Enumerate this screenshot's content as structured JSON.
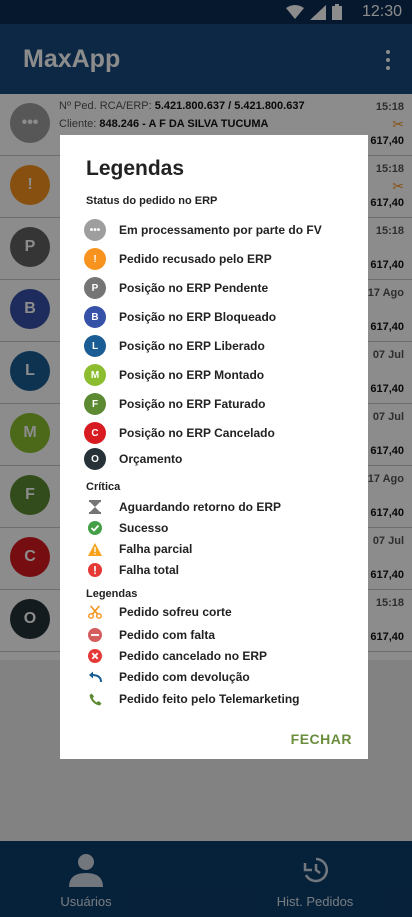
{
  "statusbar": {
    "time": "12:30"
  },
  "app": {
    "title": "MaxApp"
  },
  "orders": [
    {
      "letter": "•••",
      "color": "#9e9e9e",
      "l1_label": "Nº Ped. RCA/ERP: ",
      "l1_value": "5.421.800.637 / 5.421.800.637",
      "l2_label": "Cliente: ",
      "l2_value": "848.246 - A F DA SILVA TUCUMA",
      "time": "15:18",
      "total": "617,40",
      "cut": true
    },
    {
      "letter": "!",
      "color": "#f7931e",
      "l1_label": "",
      "l1_value": "",
      "l2_label": "",
      "l2_value": "",
      "time": "15:18",
      "total": "617,40",
      "cut": true
    },
    {
      "letter": "P",
      "color": "#616161",
      "l1_label": "",
      "l1_value": "",
      "l2_label": "",
      "l2_value": "",
      "time": "15:18",
      "total": "617,40",
      "cut": false
    },
    {
      "letter": "B",
      "color": "#3651a8",
      "l1_label": "",
      "l1_value": "",
      "l2_label": "",
      "l2_value": "",
      "time": "17 Ago",
      "total": "617,40",
      "cut": false
    },
    {
      "letter": "L",
      "color": "#1a5d94",
      "l1_label": "",
      "l1_value": "",
      "l2_label": "",
      "l2_value": "",
      "time": "07 Jul",
      "total": "617,40",
      "cut": false
    },
    {
      "letter": "M",
      "color": "#8bbd2f",
      "l1_label": "",
      "l1_value": "",
      "l2_label": "",
      "l2_value": "",
      "time": "07 Jul",
      "total": "617,40",
      "cut": false
    },
    {
      "letter": "F",
      "color": "#5c8a33",
      "l1_label": "",
      "l1_value": "",
      "l2_label": "",
      "l2_value": "",
      "time": "17 Ago",
      "total": "617,40",
      "cut": false
    },
    {
      "letter": "C",
      "color": "#d81b20",
      "l1_label": "",
      "l1_value": "",
      "l2_label": "",
      "l2_value": "",
      "time": "07 Jul",
      "total": "617,40",
      "cut": false
    },
    {
      "letter": "O",
      "color": "#263238",
      "l1_label": "",
      "l1_value": "",
      "l2_label": "",
      "l2_value": "",
      "time": "15:18",
      "total": "617,40",
      "cut": false
    }
  ],
  "bottomnav": {
    "users": "Usuários",
    "history": "Hist. Pedidos"
  },
  "dialog": {
    "title": "Legendas",
    "status_section": "Status do pedido no ERP",
    "status_items": [
      {
        "letter": "•••",
        "color": "#9e9e9e",
        "label": "Em processamento por parte do FV"
      },
      {
        "letter": "!",
        "color": "#f7931e",
        "label": "Pedido recusado pelo ERP"
      },
      {
        "letter": "P",
        "color": "#757575",
        "label": "Posição no ERP Pendente"
      },
      {
        "letter": "B",
        "color": "#3651a8",
        "label": "Posição no ERP Bloqueado"
      },
      {
        "letter": "L",
        "color": "#1a5d94",
        "label": "Posição no ERP Liberado"
      },
      {
        "letter": "M",
        "color": "#8bbd2f",
        "label": "Posição no ERP Montado"
      },
      {
        "letter": "F",
        "color": "#5c8a33",
        "label": "Posição no ERP Faturado"
      },
      {
        "letter": "C",
        "color": "#d81b20",
        "label": "Posição no ERP Cancelado"
      },
      {
        "letter": "O",
        "color": "#263238",
        "label": "Orçamento"
      }
    ],
    "critica_section": "Crítica",
    "critica_items": [
      {
        "icon": "hourglass-icon",
        "label": "Aguardando retorno do ERP"
      },
      {
        "icon": "success-check-icon",
        "label": "Sucesso"
      },
      {
        "icon": "warning-triangle-icon",
        "label": "Falha parcial"
      },
      {
        "icon": "error-circle-icon",
        "label": "Falha total"
      }
    ],
    "legend_section": "Legendas",
    "legend_items": [
      {
        "icon": "scissors-icon",
        "label": "Pedido sofreu corte"
      },
      {
        "icon": "minus-circle-icon",
        "label": "Pedido com falta"
      },
      {
        "icon": "cancel-circle-icon",
        "label": "Pedido cancelado no ERP"
      },
      {
        "icon": "return-arrow-icon",
        "label": "Pedido com devolução"
      },
      {
        "icon": "phone-icon",
        "label": "Pedido feito pelo Telemarketing"
      }
    ],
    "close_label": "FECHAR"
  }
}
